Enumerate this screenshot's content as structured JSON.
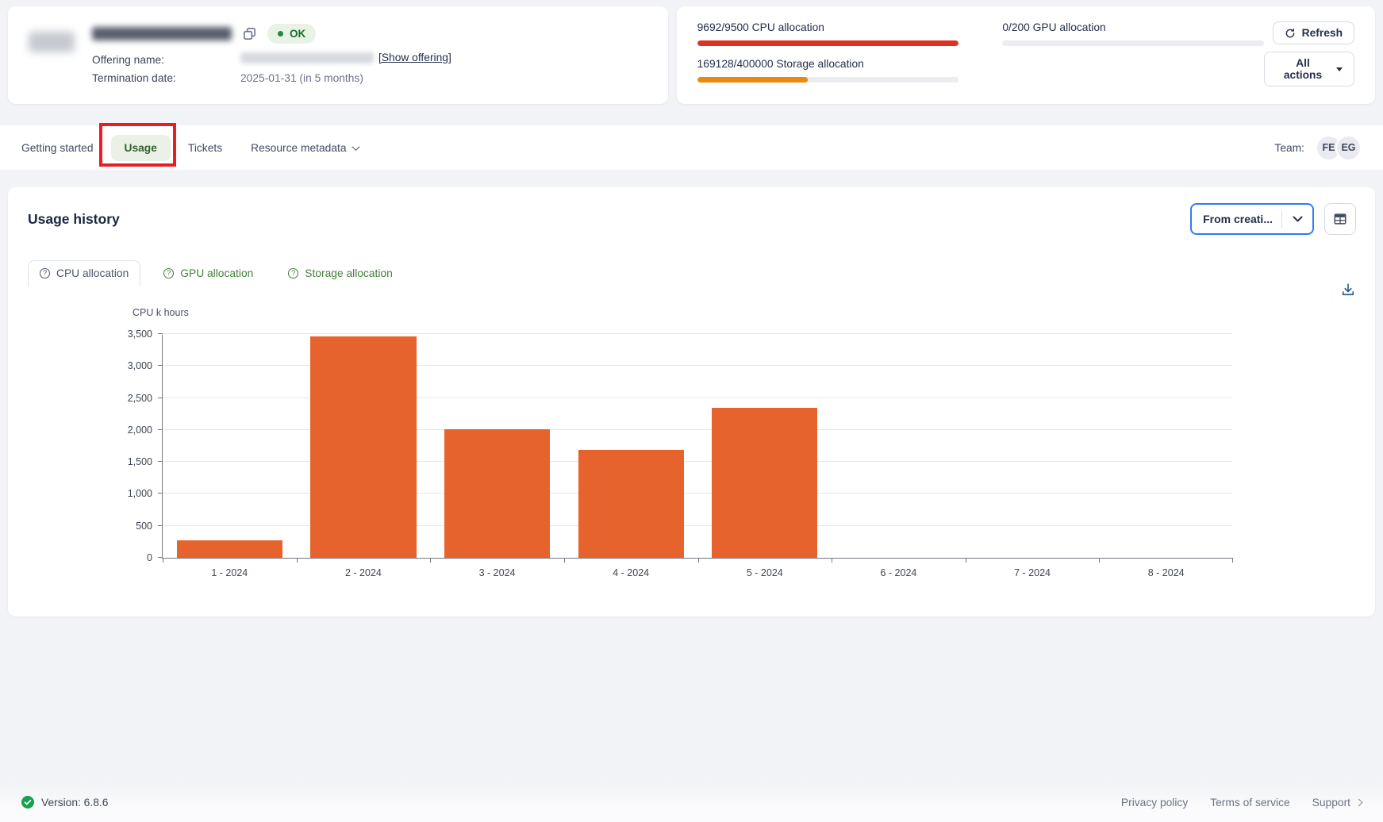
{
  "resource_header": {
    "status_badge": "OK",
    "offering_label": "Offering name:",
    "offering_link": "[Show offering]",
    "termination_label": "Termination date:",
    "termination_value": "2025-01-31 (in 5 months)"
  },
  "allocations": {
    "cpu": {
      "label": "9692/9500 CPU allocation",
      "percent": 100,
      "color": "#dc3223"
    },
    "gpu": {
      "label": "0/200 GPU allocation",
      "percent": 0,
      "color": "#e98a0d"
    },
    "storage": {
      "label": "169128/400000 Storage allocation",
      "percent": 42.3,
      "color": "#e98a0d"
    }
  },
  "actions": {
    "refresh": "Refresh",
    "all_actions": "All actions"
  },
  "tabbar": {
    "tabs": [
      {
        "label": "Getting started"
      },
      {
        "label": "Usage",
        "active": true,
        "highlighted_by_annotation": true
      },
      {
        "label": "Tickets"
      },
      {
        "label": "Resource metadata",
        "has_dropdown": true
      }
    ],
    "team_label": "Team:",
    "avatars": [
      "FE",
      "EG"
    ]
  },
  "usage_panel": {
    "title": "Usage history",
    "period_selector": "From creati...",
    "chart_tabs": [
      {
        "label": "CPU allocation",
        "active": true
      },
      {
        "label": "GPU allocation"
      },
      {
        "label": "Storage allocation"
      }
    ]
  },
  "chart_data": {
    "type": "bar",
    "ylabel": "CPU k hours",
    "categories": [
      "1 - 2024",
      "2 - 2024",
      "3 - 2024",
      "4 - 2024",
      "5 - 2024",
      "6 - 2024",
      "7 - 2024",
      "8 - 2024"
    ],
    "values": [
      270,
      3460,
      2010,
      1690,
      2340,
      0,
      0,
      0
    ],
    "ylim": [
      0,
      3500
    ],
    "ytick_step": 500,
    "bar_color": "#e7632e",
    "grid": true,
    "legend": "none"
  },
  "footer": {
    "version": "Version: 6.8.6",
    "links": [
      {
        "label": "Privacy policy"
      },
      {
        "label": "Terms of service"
      },
      {
        "label": "Support",
        "has_chevron": true
      }
    ]
  }
}
